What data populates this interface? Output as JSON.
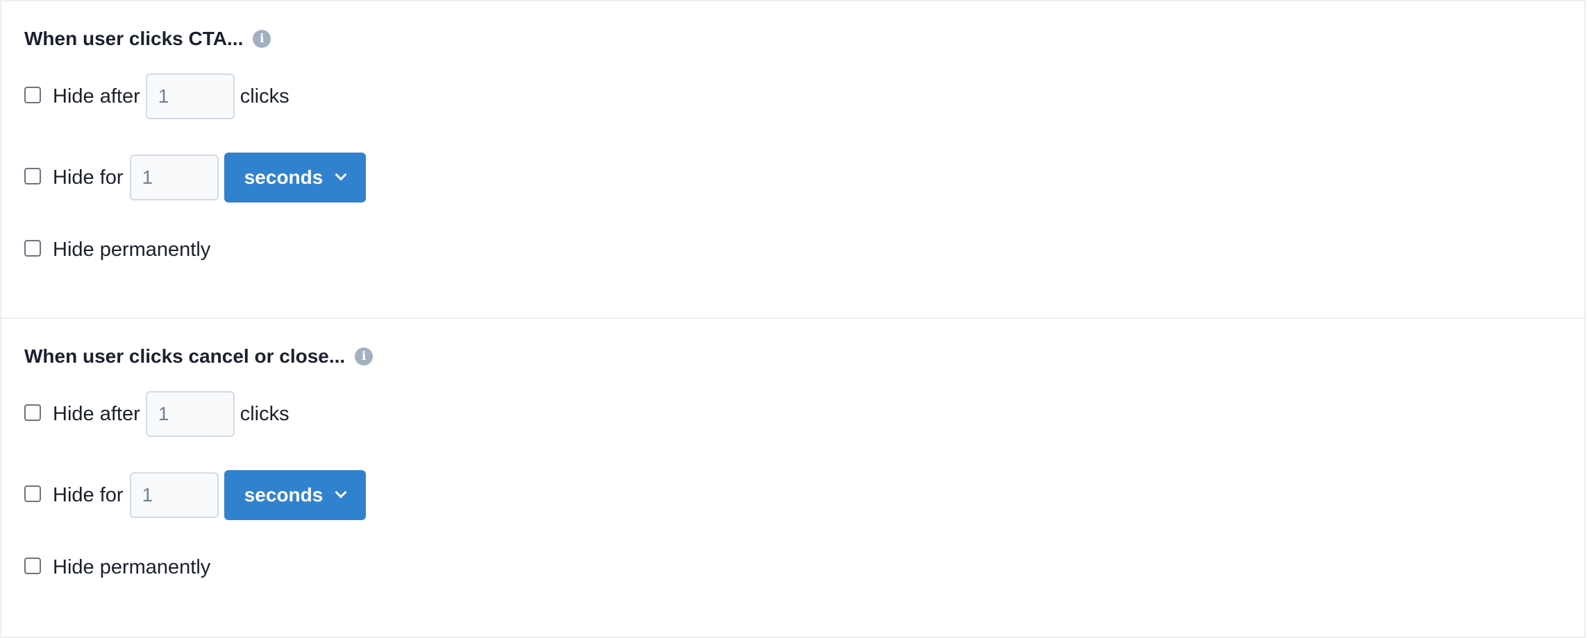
{
  "sections": [
    {
      "title": "When user clicks CTA...",
      "hide_after": {
        "label": "Hide after",
        "value": "1",
        "suffix": "clicks",
        "checked": false
      },
      "hide_for": {
        "label": "Hide for",
        "value": "1",
        "unit": "seconds",
        "checked": false
      },
      "hide_permanently": {
        "label": "Hide permanently",
        "checked": false
      }
    },
    {
      "title": "When user clicks cancel or close...",
      "hide_after": {
        "label": "Hide after",
        "value": "1",
        "suffix": "clicks",
        "checked": false
      },
      "hide_for": {
        "label": "Hide for",
        "value": "1",
        "unit": "seconds",
        "checked": false
      },
      "hide_permanently": {
        "label": "Hide permanently",
        "checked": false
      }
    }
  ],
  "icons": {
    "info": "info-icon",
    "chevron": "chevron-down-icon"
  },
  "colors": {
    "accent": "#3182ce",
    "info_icon": "#a3b0c2",
    "input_bg": "#f8fafc",
    "border": "#d4dbe6"
  }
}
